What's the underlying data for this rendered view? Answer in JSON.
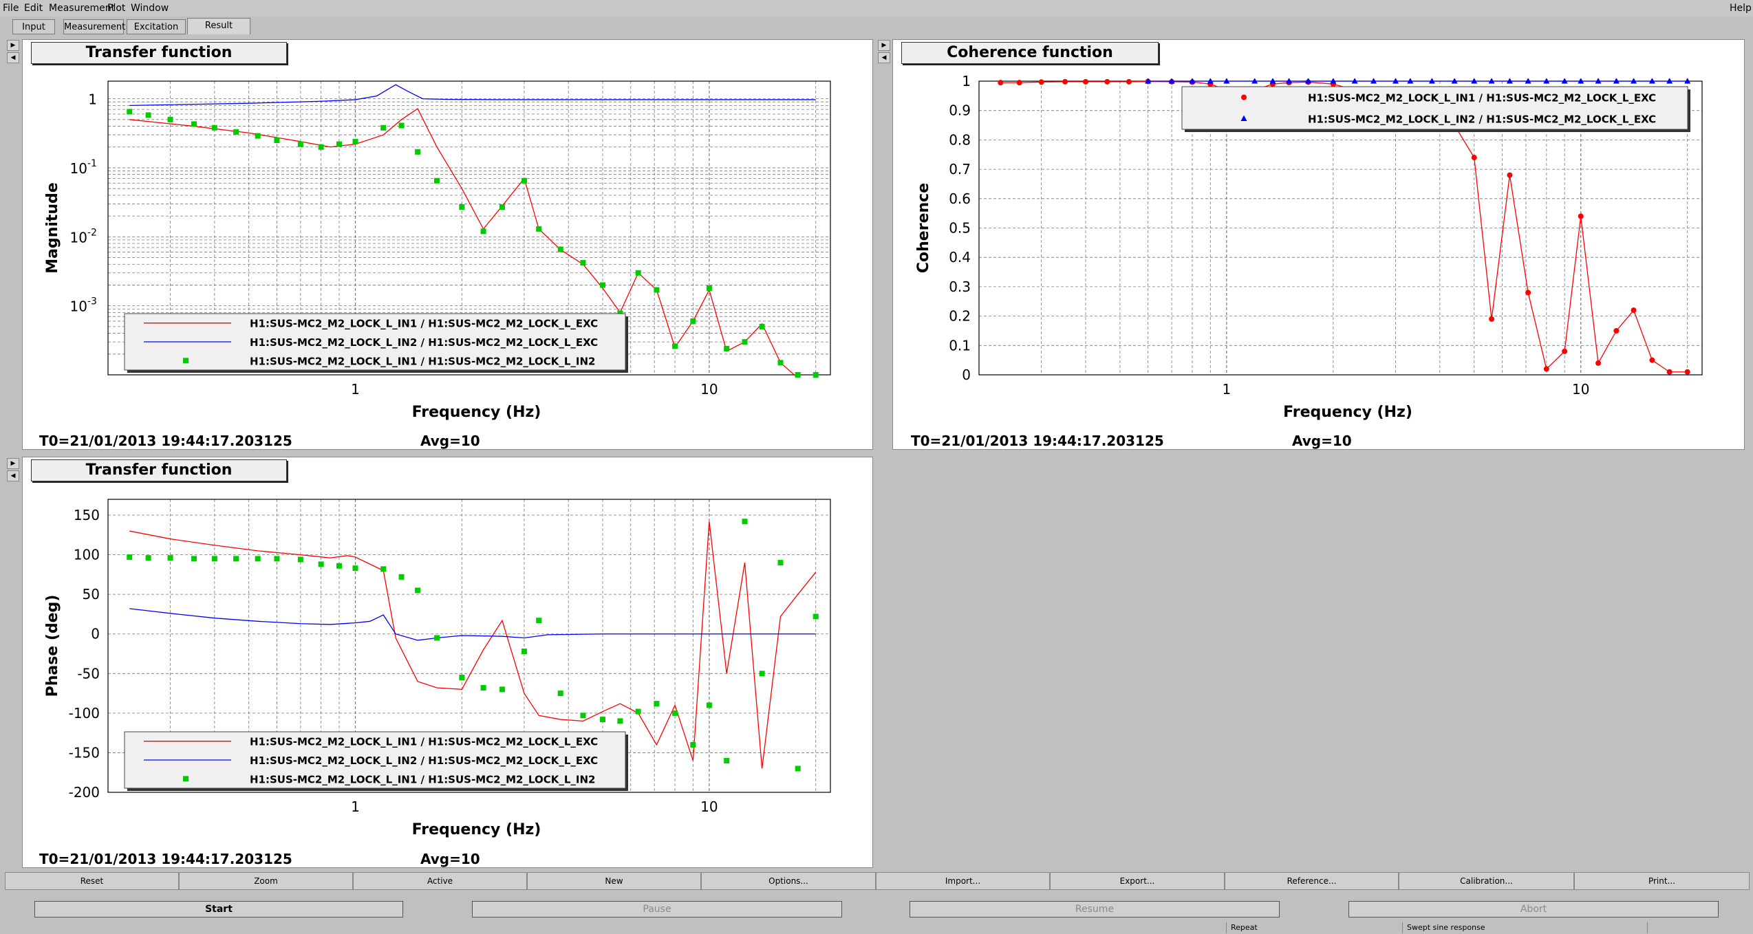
{
  "menu": {
    "file": "File",
    "edit": "Edit",
    "measurement": "Measurement",
    "plot": "Plot",
    "window": "Window",
    "help": "Help"
  },
  "tabs": [
    "Input",
    "Measurement",
    "Excitation",
    "Result"
  ],
  "info": {
    "t0": "T0=21/01/2013 19:44:17.203125",
    "avg": "Avg=10"
  },
  "toolbar": [
    "Reset",
    "Zoom",
    "Active",
    "New",
    "Options...",
    "Import...",
    "Export...",
    "Reference...",
    "Calibration...",
    "Print..."
  ],
  "controls": {
    "start": "Start",
    "pause": "Pause",
    "resume": "Resume",
    "abort": "Abort"
  },
  "status": {
    "repeat": "Repeat",
    "mode": "Swept sine response"
  },
  "colors": {
    "in1_exc": "#ff0000",
    "in2_exc": "#0000ff",
    "in1_in2": "#00cc00"
  },
  "panels": {
    "tf_mag": {
      "title": "Transfer function"
    },
    "coh": {
      "title": "Coherence function"
    },
    "tf_phase": {
      "title": "Transfer function"
    }
  },
  "chart_data": [
    {
      "type": "line",
      "title": "Transfer function",
      "xlabel": "Frequency (Hz)",
      "ylabel": "Magnitude",
      "xscale": "log",
      "yscale": "log",
      "xlim": [
        0.2,
        22
      ],
      "ylim": [
        0.0001,
        1.8
      ],
      "xticks": [
        "1",
        "10"
      ],
      "yticks": [
        "1",
        "10^-1",
        "10^-2",
        "10^-3"
      ],
      "legend_position": "bottom-left",
      "series": [
        {
          "name": "H1:SUS-MC2_M2_LOCK_L_IN1 / H1:SUS-MC2_M2_LOCK_L_EXC",
          "color": "#ff0000",
          "marker": "none",
          "x": [
            0.23,
            0.35,
            0.5,
            0.7,
            0.85,
            1.0,
            1.2,
            1.35,
            1.5,
            1.7,
            2.0,
            2.3,
            2.6,
            3.0,
            3.3,
            3.8,
            4.4,
            5.0,
            5.6,
            6.3,
            7.1,
            8.0,
            9.0,
            10.0,
            11.2,
            12.6,
            14.1,
            15.9,
            17.8,
            20.0
          ],
          "y": [
            0.5,
            0.4,
            0.32,
            0.24,
            0.2,
            0.22,
            0.3,
            0.5,
            0.72,
            0.2,
            0.05,
            0.013,
            0.028,
            0.07,
            0.013,
            0.0065,
            0.004,
            0.0018,
            0.0008,
            0.003,
            0.0017,
            0.00025,
            0.0006,
            0.0017,
            0.00022,
            0.0003,
            0.00055,
            0.00015,
            9e-05,
            9e-05
          ]
        },
        {
          "name": "H1:SUS-MC2_M2_LOCK_L_IN2 / H1:SUS-MC2_M2_LOCK_L_EXC",
          "color": "#0000ff",
          "marker": "none",
          "x": [
            0.23,
            0.5,
            0.8,
            1.0,
            1.15,
            1.3,
            1.4,
            1.55,
            1.8,
            2.5,
            5,
            10,
            20
          ],
          "y": [
            0.8,
            0.86,
            0.92,
            0.97,
            1.1,
            1.6,
            1.3,
            1.0,
            0.98,
            0.97,
            0.97,
            0.97,
            0.97
          ]
        },
        {
          "name": "H1:SUS-MC2_M2_LOCK_L_IN1 / H1:SUS-MC2_M2_LOCK_L_IN2",
          "color": "#00cc00",
          "marker": "square",
          "x": [
            0.23,
            0.26,
            0.3,
            0.35,
            0.4,
            0.46,
            0.53,
            0.6,
            0.7,
            0.8,
            0.9,
            1.0,
            1.2,
            1.35,
            1.5,
            1.7,
            2.0,
            2.3,
            2.6,
            3.0,
            3.3,
            3.8,
            4.4,
            5.0,
            5.6,
            6.3,
            7.1,
            8.0,
            9.0,
            10.0,
            11.2,
            12.6,
            14.1,
            15.9,
            17.8,
            20.0
          ],
          "y": [
            0.65,
            0.58,
            0.5,
            0.43,
            0.38,
            0.33,
            0.29,
            0.25,
            0.22,
            0.2,
            0.22,
            0.24,
            0.38,
            0.41,
            0.17,
            0.065,
            0.027,
            0.012,
            0.027,
            0.065,
            0.013,
            0.0066,
            0.0042,
            0.002,
            0.00078,
            0.003,
            0.0017,
            0.00026,
            0.0006,
            0.0018,
            0.00024,
            0.0003,
            0.0005,
            0.00015,
            0.0001,
            0.0001
          ]
        }
      ]
    },
    {
      "type": "line",
      "title": "Coherence function",
      "xlabel": "Frequency (Hz)",
      "ylabel": "Coherence",
      "xscale": "log",
      "yscale": "linear",
      "xlim": [
        0.2,
        22
      ],
      "ylim": [
        0,
        1
      ],
      "xticks": [
        "1",
        "10"
      ],
      "yticks": [
        "0",
        "0.1",
        "0.2",
        "0.3",
        "0.4",
        "0.5",
        "0.6",
        "0.7",
        "0.8",
        "0.9",
        "1"
      ],
      "legend_position": "top-right",
      "series": [
        {
          "name": "H1:SUS-MC2_M2_LOCK_L_IN1 / H1:SUS-MC2_M2_LOCK_L_EXC",
          "color": "#ff0000",
          "marker": "circle",
          "x": [
            0.23,
            0.26,
            0.3,
            0.35,
            0.4,
            0.46,
            0.53,
            0.6,
            0.7,
            0.8,
            0.9,
            1.0,
            1.2,
            1.35,
            1.5,
            1.7,
            2.0,
            2.3,
            2.6,
            3.0,
            3.3,
            3.8,
            4.4,
            5.0,
            5.6,
            6.3,
            7.1,
            8.0,
            9.0,
            10.0,
            11.2,
            12.6,
            14.1,
            15.9,
            17.8,
            20.0
          ],
          "y": [
            0.995,
            0.995,
            0.997,
            0.998,
            0.998,
            0.998,
            0.998,
            0.999,
            0.998,
            0.997,
            0.99,
            0.97,
            0.97,
            0.99,
            0.995,
            0.997,
            0.99,
            0.97,
            0.97,
            0.97,
            0.96,
            0.93,
            0.85,
            0.74,
            0.19,
            0.68,
            0.28,
            0.02,
            0.08,
            0.54,
            0.04,
            0.15,
            0.22,
            0.05,
            0.01,
            0.01
          ]
        },
        {
          "name": "H1:SUS-MC2_M2_LOCK_L_IN2 / H1:SUS-MC2_M2_LOCK_L_EXC",
          "color": "#0000ff",
          "marker": "triangle",
          "x": [
            0.6,
            0.7,
            0.8,
            0.9,
            1.0,
            1.2,
            1.35,
            1.5,
            1.7,
            2.0,
            2.3,
            2.6,
            3.0,
            3.3,
            3.8,
            4.4,
            5.0,
            5.6,
            6.3,
            7.1,
            8.0,
            9.0,
            10.0,
            11.2,
            12.6,
            14.1,
            15.9,
            17.8,
            20.0
          ],
          "y": [
            1,
            1,
            1,
            1,
            1,
            1,
            1,
            1,
            1,
            1,
            1,
            1,
            1,
            1,
            1,
            1,
            1,
            1,
            1,
            1,
            1,
            1,
            1,
            1,
            1,
            1,
            1,
            1,
            1
          ]
        }
      ]
    },
    {
      "type": "line",
      "title": "Transfer function",
      "xlabel": "Frequency (Hz)",
      "ylabel": "Phase (deg)",
      "xscale": "log",
      "yscale": "linear",
      "xlim": [
        0.2,
        22
      ],
      "ylim": [
        -200,
        170
      ],
      "xticks": [
        "1",
        "10"
      ],
      "yticks": [
        "150",
        "100",
        "50",
        "0",
        "-50",
        "-100",
        "-150",
        "-200"
      ],
      "legend_position": "bottom-left",
      "series": [
        {
          "name": "H1:SUS-MC2_M2_LOCK_L_IN1 / H1:SUS-MC2_M2_LOCK_L_EXC",
          "color": "#ff0000",
          "marker": "none",
          "x": [
            0.23,
            0.3,
            0.4,
            0.53,
            0.7,
            0.85,
            0.95,
            1.0,
            1.2,
            1.3,
            1.5,
            1.7,
            2.0,
            2.3,
            2.6,
            3.0,
            3.3,
            3.8,
            4.4,
            5.0,
            5.6,
            6.3,
            7.1,
            8.0,
            9.0,
            10.0,
            11.2,
            12.6,
            14.1,
            15.9,
            17.8,
            20.0
          ],
          "y": [
            130,
            120,
            112,
            105,
            100,
            96,
            99,
            97,
            80,
            -5,
            -60,
            -68,
            -70,
            -20,
            17,
            -75,
            -103,
            -108,
            -110,
            -98,
            -88,
            -100,
            -140,
            -90,
            -160,
            142,
            -50,
            90,
            -170,
            22,
            50,
            78
          ]
        },
        {
          "name": "H1:SUS-MC2_M2_LOCK_L_IN2 / H1:SUS-MC2_M2_LOCK_L_EXC",
          "color": "#0000ff",
          "marker": "none",
          "x": [
            0.23,
            0.3,
            0.4,
            0.53,
            0.7,
            0.85,
            1.0,
            1.1,
            1.2,
            1.3,
            1.5,
            1.7,
            2.0,
            2.6,
            3.0,
            3.5,
            5,
            10,
            20
          ],
          "y": [
            32,
            26,
            20,
            16,
            13,
            12,
            14,
            16,
            24,
            0,
            -8,
            -5,
            -2,
            -3,
            -5,
            -1,
            0,
            0,
            0
          ]
        },
        {
          "name": "H1:SUS-MC2_M2_LOCK_L_IN1 / H1:SUS-MC2_M2_LOCK_L_IN2",
          "color": "#00cc00",
          "marker": "square",
          "x": [
            0.23,
            0.26,
            0.3,
            0.35,
            0.4,
            0.46,
            0.53,
            0.6,
            0.7,
            0.8,
            0.9,
            1.0,
            1.2,
            1.35,
            1.5,
            1.7,
            2.0,
            2.3,
            2.6,
            3.0,
            3.3,
            3.8,
            4.4,
            5.0,
            5.6,
            6.3,
            7.1,
            8.0,
            9.0,
            10.0,
            11.2,
            12.6,
            14.1,
            15.9,
            17.8,
            20.0
          ],
          "y": [
            97,
            96,
            96,
            95,
            95,
            95,
            95,
            95,
            94,
            88,
            86,
            83,
            82,
            72,
            55,
            -5,
            -55,
            -68,
            -70,
            -22,
            17,
            -75,
            -103,
            -108,
            -110,
            -98,
            -88,
            -100,
            -140,
            -90,
            -160,
            142,
            -50,
            90,
            -170,
            22
          ]
        }
      ]
    }
  ]
}
